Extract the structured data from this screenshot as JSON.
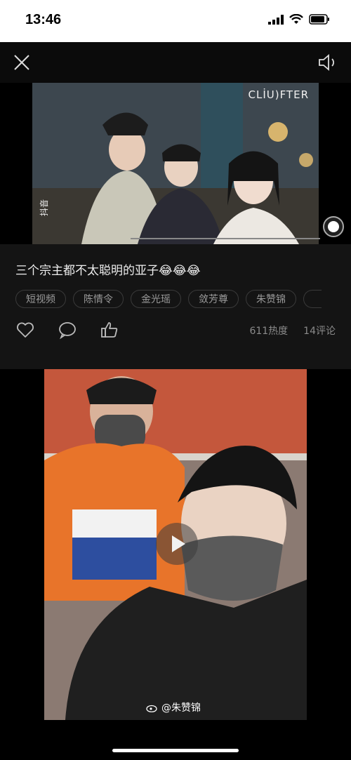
{
  "status_bar": {
    "time": "13:46"
  },
  "video1": {
    "watermark": "CLİU)FTER",
    "app_mark": "抖音"
  },
  "post": {
    "caption": "三个宗主都不太聪明的亚子😂😂😂",
    "tags": [
      "短视频",
      "陈情令",
      "金光瑶",
      "敛芳尊",
      "朱赞锦"
    ],
    "heat": "611热度",
    "comments": "14评论"
  },
  "video2": {
    "credit": "@朱赞锦"
  },
  "icons": {
    "close": "close-icon",
    "sound": "speaker-icon",
    "like": "heart-icon",
    "comment": "comment-icon",
    "thumb": "thumbs-up-icon",
    "play": "play-icon",
    "record": "record-icon"
  }
}
